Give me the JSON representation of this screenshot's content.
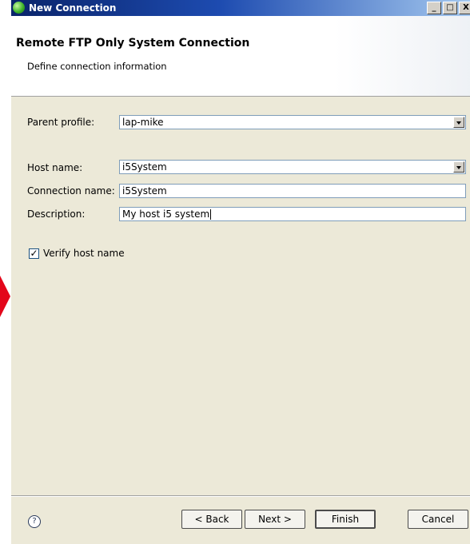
{
  "window": {
    "title": "New Connection",
    "controls": [
      "_",
      "□",
      "X"
    ]
  },
  "header": {
    "title": "Remote FTP Only System Connection",
    "description": "Define connection information"
  },
  "form": {
    "parent_profile_label": "Parent profile:",
    "parent_profile_value": "lap-mike",
    "host_name_label": "Host name:",
    "host_name_value": "i5System",
    "connection_name_label": "Connection name:",
    "connection_name_value": "i5System",
    "description_label": "Description:",
    "description_value": "My host i5 system",
    "verify_label": "Verify host name",
    "verify_checked": true,
    "verify_mark": "✓"
  },
  "buttons": {
    "help": "?",
    "back": "< Back",
    "next": "Next >",
    "finish": "Finish",
    "cancel": "Cancel"
  },
  "colors": {
    "titlebar": "#0a246a",
    "dialog_bg": "#ece9d8",
    "arrow": "#e3061a"
  }
}
